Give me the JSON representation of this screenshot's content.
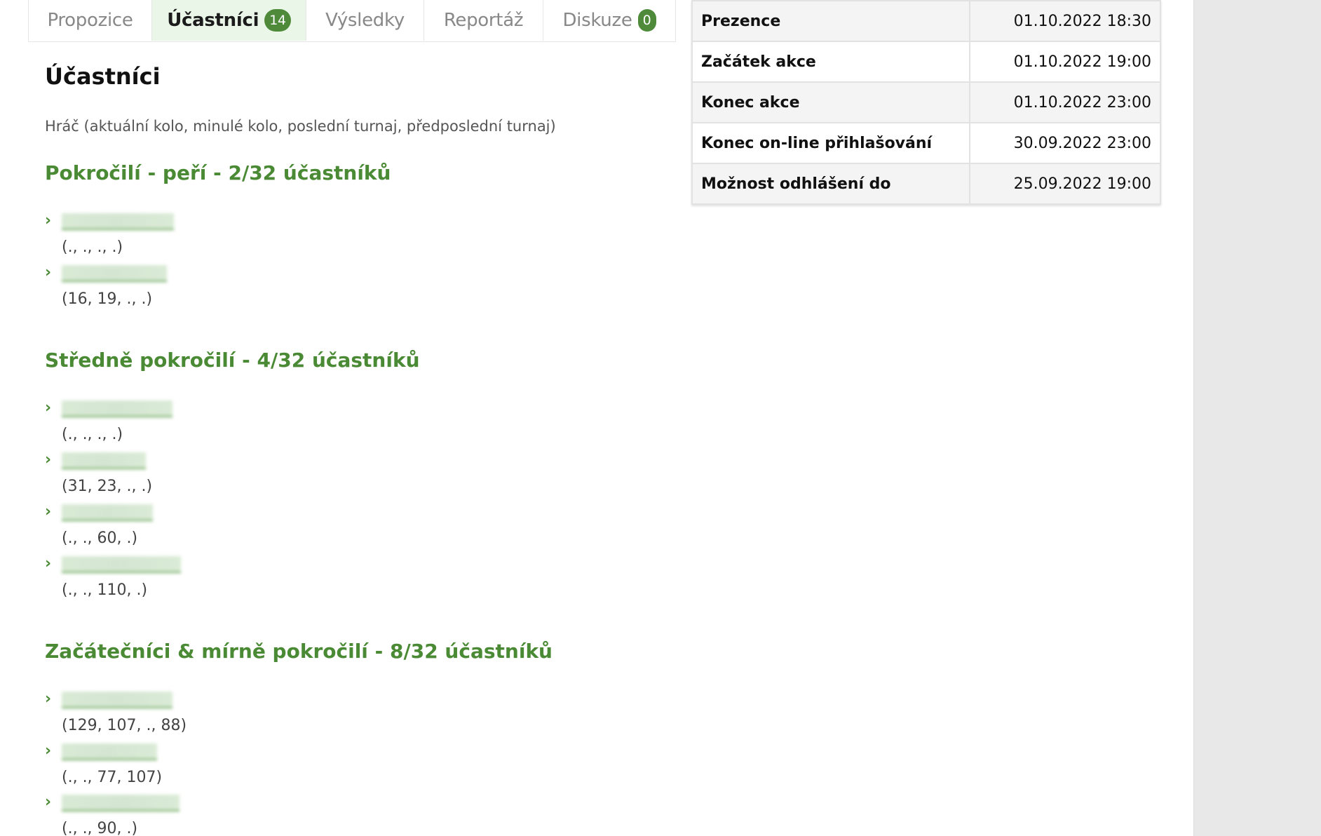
{
  "tabs": [
    {
      "label": "Propozice",
      "badge": null
    },
    {
      "label": "Účastníci",
      "badge": "14"
    },
    {
      "label": "Výsledky",
      "badge": null
    },
    {
      "label": "Reportáž",
      "badge": null
    },
    {
      "label": "Diskuze",
      "badge": "0"
    }
  ],
  "schedule": [
    {
      "label": "Prezence",
      "value": "01.10.2022 18:30"
    },
    {
      "label": "Začátek akce",
      "value": "01.10.2022 19:00"
    },
    {
      "label": "Konec akce",
      "value": "01.10.2022 23:00"
    },
    {
      "label": "Konec on-line přihlašování",
      "value": "30.09.2022 23:00"
    },
    {
      "label": "Možnost odhlášení do",
      "value": "25.09.2022 19:00"
    }
  ],
  "page_title": "Účastníci",
  "legend": "Hráč (aktuální kolo, minulé kolo, poslední turnaj, předposlední turnaj)",
  "groups": [
    {
      "title": "Pokročilí - peří - 2/32 účastníků",
      "players": [
        {
          "name": "",
          "stats": "(., ., ., .)"
        },
        {
          "name": "",
          "stats": "(16, 19, ., .)"
        }
      ]
    },
    {
      "title": "Středně pokročilí - 4/32 účastníků",
      "players": [
        {
          "name": "",
          "stats": "(., ., ., .)"
        },
        {
          "name": "",
          "stats": "(31, 23, ., .)"
        },
        {
          "name": "",
          "stats": "(., ., 60, .)"
        },
        {
          "name": "",
          "stats": "(., ., 110, .)"
        }
      ]
    },
    {
      "title": "Začátečníci & mírně pokročilí - 8/32 účastníků",
      "players": [
        {
          "name": "",
          "stats": "(129, 107, ., 88)"
        },
        {
          "name": "",
          "stats": "(., ., 77, 107)"
        },
        {
          "name": "",
          "stats": "(., ., 90, .)"
        }
      ]
    }
  ],
  "chevron_icon": "chevron-right-icon",
  "colors": {
    "accent": "#4b8a35",
    "active_tab_bg": "#eaf7e8",
    "badge": "#4e8a3a"
  }
}
